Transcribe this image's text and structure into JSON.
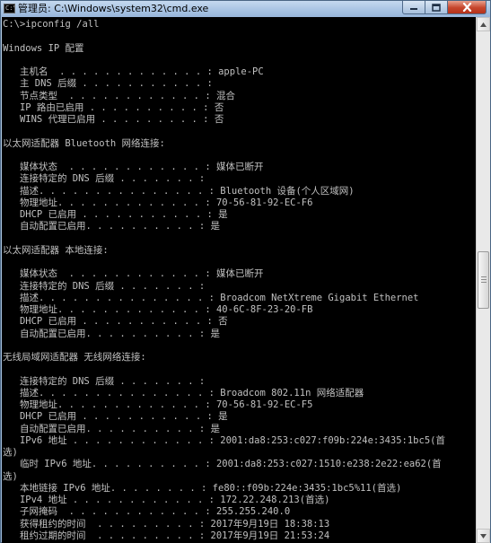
{
  "window": {
    "title": "管理员: C:\\Windows\\system32\\cmd.exe",
    "icon_text": "C:\\",
    "icon": "console-app-icon",
    "controls": [
      "minimize-icon",
      "maximize-icon",
      "close-icon"
    ]
  },
  "console": {
    "lines": [
      "C:\\>ipconfig /all",
      "",
      "Windows IP 配置",
      "",
      "   主机名  . . . . . . . . . . . . . : apple-PC",
      "   主 DNS 后缀 . . . . . . . . . . . :",
      "   节点类型  . . . . . . . . . . . . : 混合",
      "   IP 路由已启用 . . . . . . . . . . : 否",
      "   WINS 代理已启用 . . . . . . . . . : 否",
      "",
      "以太网适配器 Bluetooth 网络连接:",
      "",
      "   媒体状态  . . . . . . . . . . . . : 媒体已断开",
      "   连接特定的 DNS 后缀 . . . . . . . :",
      "   描述. . . . . . . . . . . . . . . : Bluetooth 设备(个人区域网)",
      "   物理地址. . . . . . . . . . . . . : 70-56-81-92-EC-F6",
      "   DHCP 已启用 . . . . . . . . . . . : 是",
      "   自动配置已启用. . . . . . . . . . : 是",
      "",
      "以太网适配器 本地连接:",
      "",
      "   媒体状态  . . . . . . . . . . . . : 媒体已断开",
      "   连接特定的 DNS 后缀 . . . . . . . :",
      "   描述. . . . . . . . . . . . . . . : Broadcom NetXtreme Gigabit Ethernet",
      "   物理地址. . . . . . . . . . . . . : 40-6C-8F-23-20-FB",
      "   DHCP 已启用 . . . . . . . . . . . : 否",
      "   自动配置已启用. . . . . . . . . . : 是",
      "",
      "无线局域网适配器 无线网络连接:",
      "",
      "   连接特定的 DNS 后缀 . . . . . . . :",
      "   描述. . . . . . . . . . . . . . . : Broadcom 802.11n 网络适配器",
      "   物理地址. . . . . . . . . . . . . : 70-56-81-92-EC-F5",
      "   DHCP 已启用 . . . . . . . . . . . : 是",
      "   自动配置已启用. . . . . . . . . . : 是",
      "   IPv6 地址 . . . . . . . . . . . . : 2001:da8:253:c027:f09b:224e:3435:1bc5(首",
      "选)",
      "   临时 IPv6 地址. . . . . . . . . . : 2001:da8:253:c027:1510:e238:2e22:ea62(首",
      "选)",
      "   本地链接 IPv6 地址. . . . . . . . : fe80::f09b:224e:3435:1bc5%11(首选)",
      "   IPv4 地址 . . . . . . . . . . . . : 172.22.248.213(首选)",
      "   子网掩码  . . . . . . . . . . . . : 255.255.240.0",
      "   获得租约的时间  . . . . . . . . . : 2017年9月19日 18:38:13",
      "   租约过期的时间  . . . . . . . . . : 2017年9月19日 21:53:24"
    ]
  },
  "scrollbar": {
    "position_fraction": 0.5
  },
  "colors": {
    "console_bg": "#000000",
    "console_text": "#c0c0c0",
    "titlebar": "#a9c4e3",
    "close_button": "#c6452c"
  }
}
